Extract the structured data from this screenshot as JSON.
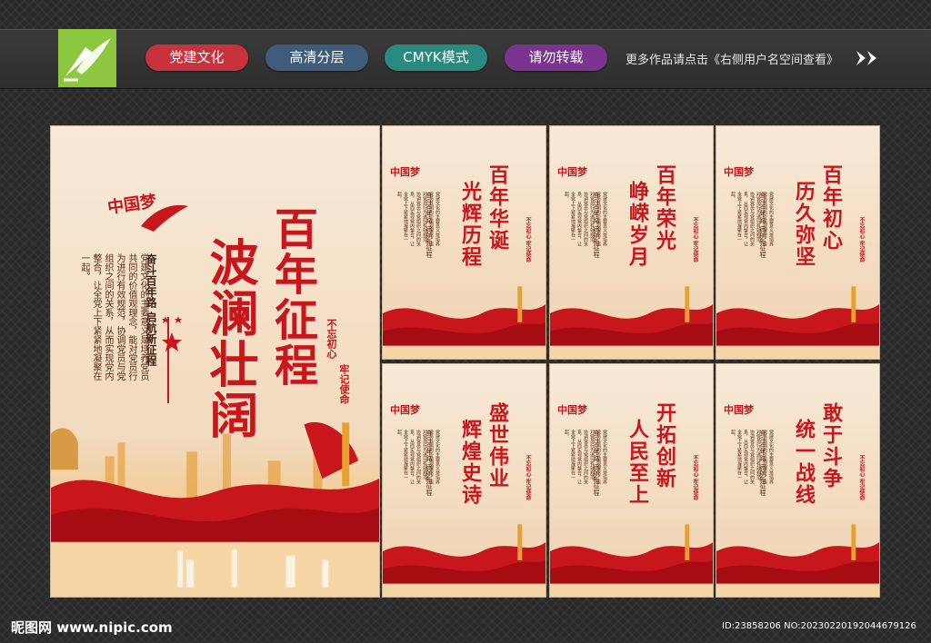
{
  "banner": {
    "tags": [
      "党建文化",
      "高清分层",
      "CMYK模式",
      "请勿转载"
    ],
    "note": "更多作品请点击《右侧用户名空间查看》",
    "colors": [
      "#c8323c",
      "#3f5d7b",
      "#2a8a7f",
      "#7b3590"
    ]
  },
  "main_poster": {
    "title_right": "百年征程",
    "title_left": "波澜壮阔",
    "slogan_1": "不忘初心",
    "slogan_2": "牢记使命",
    "subheading": "奋斗百年路 启航新征程",
    "body": "党建文化的主要意义是培养党员共同的价值观理念，能对党员行为进行有效规范，协调党员与党组织之间的关系，从而实现党内整合，让全党上下紧紧地凝聚在一起。",
    "logo": "中国梦"
  },
  "posters": [
    {
      "title": [
        "百年华诞",
        "光辉历程"
      ]
    },
    {
      "title": [
        "百年荣光",
        "峥嵘岁月"
      ]
    },
    {
      "title": [
        "百年初心",
        "历久弥坚"
      ]
    },
    {
      "title": [
        "盛世伟业",
        "辉煌史诗"
      ]
    },
    {
      "title": [
        "开拓创新",
        "人民至上"
      ]
    },
    {
      "title": [
        "敢于斗争",
        "统一战线"
      ]
    }
  ],
  "small_poster_subheading": "奋斗百年路 启航新征程",
  "small_poster_slogan": "不忘初心 牢记使命",
  "small_poster_body": "党建文化的主要意义是培养党员共同的价值观理念，能对党员行为进行有效规范，协调党员与党组织之间的关系，从而实现党内整合，让全党上下紧紧地凝聚在一起。",
  "watermark": {
    "site": "昵图网 www.nipic.com",
    "id": "ID:23858206 NO:20230220192044679126"
  },
  "accent": "#c8161d"
}
